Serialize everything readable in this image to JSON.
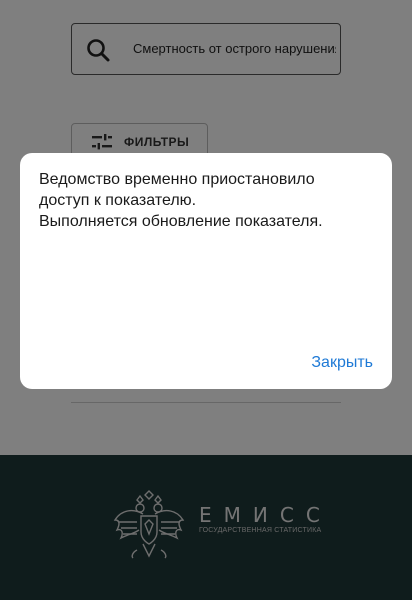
{
  "search": {
    "value": "Смертность от острого нарушения"
  },
  "filters": {
    "label": "ФИЛЬТРЫ"
  },
  "footer": {
    "logo_title": "ЕМИСС",
    "logo_subtitle": "ГОСУДАРСТВЕННАЯ СТАТИСТИКА"
  },
  "dialog": {
    "line1": "Ведомство временно приостановило",
    "line2": "доступ к показателю.",
    "line3": "Выполняется обновление показателя.",
    "close_label": "Закрыть"
  },
  "colors": {
    "footer_bg": "#1e3838",
    "accent": "#1f7ad6"
  },
  "icons": [
    "search-icon",
    "filters-icon",
    "emblem-logo-icon"
  ]
}
